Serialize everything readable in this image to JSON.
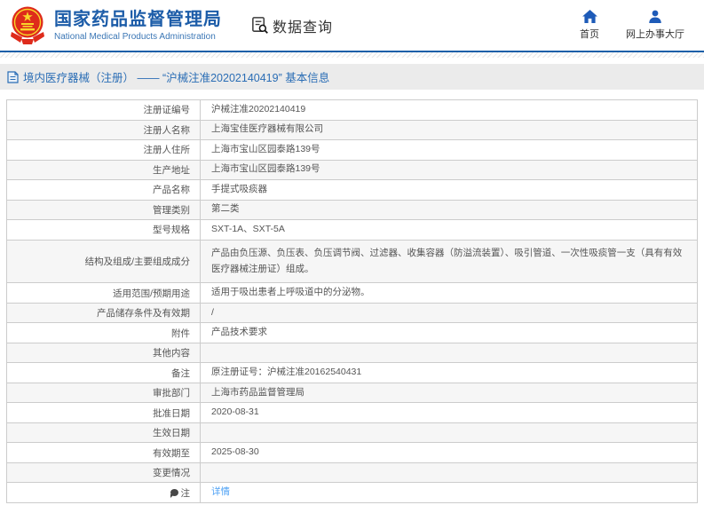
{
  "header": {
    "agency_name_cn": "国家药品监督管理局",
    "agency_name_en": "National Medical Products Administration",
    "section_title": "数据查询",
    "nav": [
      {
        "label": "首页",
        "icon": "home-icon"
      },
      {
        "label": "网上办事大厅",
        "icon": "user-icon"
      }
    ]
  },
  "breadcrumb": {
    "text": "境内医疗器械（注册） ——  “沪械注准20202140419”  基本信息"
  },
  "table": {
    "rows": [
      {
        "label": "注册证编号",
        "value": "沪械注准20202140419"
      },
      {
        "label": "注册人名称",
        "value": "上海宝佳医疗器械有限公司"
      },
      {
        "label": "注册人住所",
        "value": "上海市宝山区园泰路139号"
      },
      {
        "label": "生产地址",
        "value": "上海市宝山区园泰路139号"
      },
      {
        "label": "产品名称",
        "value": "手提式吸痰器"
      },
      {
        "label": "管理类别",
        "value": "第二类"
      },
      {
        "label": "型号规格",
        "value": "SXT-1A、SXT-5A"
      },
      {
        "label": "结构及组成/主要组成成分",
        "value": "产品由负压源、负压表、负压调节阀、过滤器、收集容器（防溢流装置）、吸引管道、一次性吸痰管一支（具有有效医疗器械注册证）组成。"
      },
      {
        "label": "适用范围/预期用途",
        "value": "适用于吸出患者上呼吸道中的分泌物。"
      },
      {
        "label": "产品储存条件及有效期",
        "value": "/"
      },
      {
        "label": "附件",
        "value": "产品技术要求"
      },
      {
        "label": "其他内容",
        "value": ""
      },
      {
        "label": "备注",
        "value": "原注册证号：沪械注准20162540431"
      },
      {
        "label": "审批部门",
        "value": "上海市药品监督管理局"
      },
      {
        "label": "批准日期",
        "value": "2020-08-31"
      },
      {
        "label": "生效日期",
        "value": ""
      },
      {
        "label": "有效期至",
        "value": "2025-08-30"
      },
      {
        "label": "变更情况",
        "value": ""
      },
      {
        "label": "注",
        "icon": "note-icon",
        "value": "详情",
        "link": true
      }
    ]
  },
  "colors": {
    "brand_blue": "#1c5ca8",
    "divider_blue": "#1b5fa8",
    "crumb_bg": "#ebebeb",
    "stripe_bg": "#f6f6f6",
    "border": "#cccccc",
    "link_blue": "#4da1f5",
    "emblem_red": "#de2b1b",
    "emblem_yellow": "#f8d62a"
  }
}
